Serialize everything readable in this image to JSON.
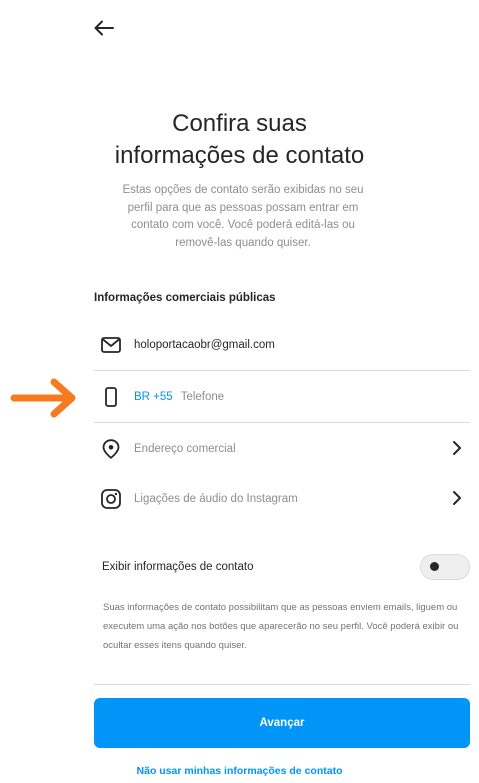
{
  "header": {
    "back_icon": "arrow-left-icon"
  },
  "title": {
    "line1": "Confira suas",
    "line2": "informações de contato"
  },
  "subtitle": "Estas opções de contato serão exibidas no seu perfil para que as pessoas possam entrar em contato com você. Você poderá editá-las ou removê-las quando quiser.",
  "section_label": "Informações comerciais públicas",
  "contact": {
    "email": {
      "icon": "mail-icon",
      "value": "holoportacaobr@gmail.com"
    },
    "phone": {
      "icon": "phone-icon",
      "country_code": "BR +55",
      "placeholder": "Telefone"
    },
    "address": {
      "icon": "location-pin-icon",
      "label": "Endereço comercial"
    },
    "audio_calls": {
      "icon": "instagram-icon",
      "label": "Ligações de áudio do Instagram"
    }
  },
  "display_toggle": {
    "label": "Exibir informações de contato",
    "state": "off"
  },
  "info_text": "Suas informações de contato possibilitam que as pessoas enviem emails, liguem ou executem uma ação nos botões que aparecerão no seu perfil. Você poderá exibir ou ocultar esses itens quando quiser.",
  "buttons": {
    "next": "Avançar",
    "skip": "Não usar minhas informações de contato"
  },
  "annotation": {
    "icon": "orange-arrow-icon",
    "color": "#f47b20"
  },
  "colors": {
    "accent": "#0095f6",
    "text": "#262626",
    "muted": "#8e8e8e",
    "divider": "#dbdbdb"
  }
}
